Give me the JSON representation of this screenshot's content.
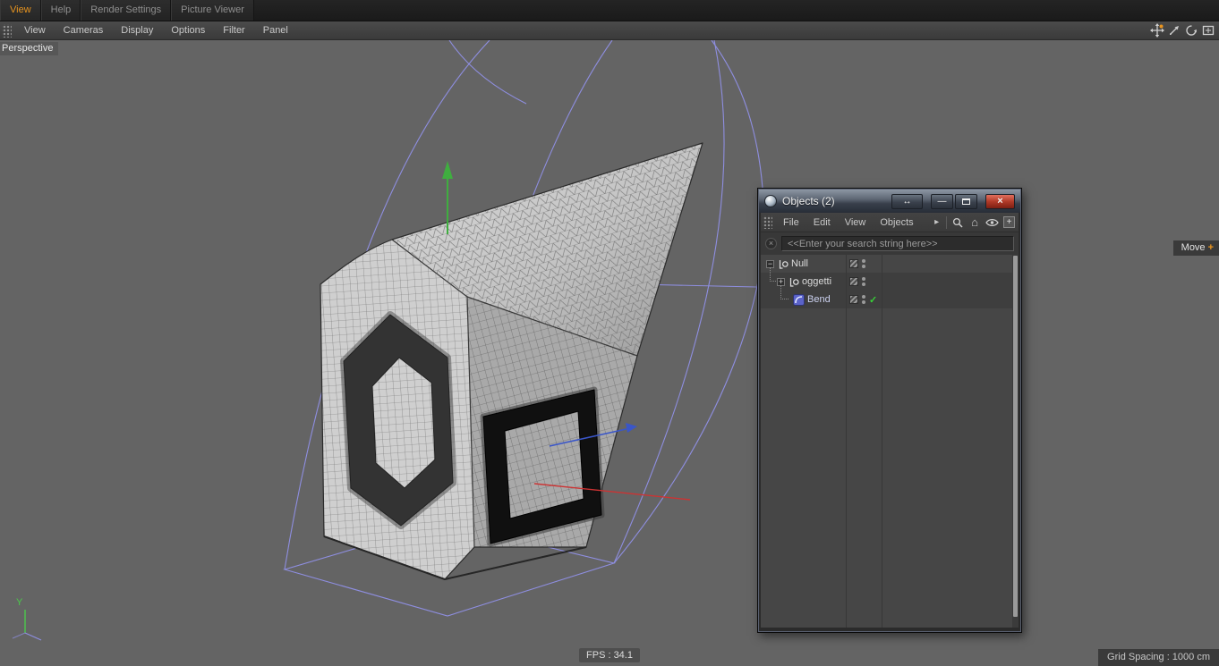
{
  "colors": {
    "accent_orange": "#e8941f",
    "cage_purple": "#8e8ee0",
    "axis_green": "#3fae3f",
    "axis_red": "#cc3333",
    "axis_blue": "#3a56c8",
    "check_green": "#38d038",
    "viewport_bg": "#646464"
  },
  "top_tabs": {
    "items": [
      {
        "label": "View",
        "active": true
      },
      {
        "label": "Help",
        "active": false
      },
      {
        "label": "Render Settings",
        "active": false
      },
      {
        "label": "Picture Viewer",
        "active": false
      }
    ]
  },
  "menu_bar": {
    "items": [
      "View",
      "Cameras",
      "Display",
      "Options",
      "Filter",
      "Panel"
    ]
  },
  "viewport": {
    "camera_label": "Perspective",
    "fps_label": "FPS : 34.1",
    "axis_label": "Y"
  },
  "status": {
    "grid_spacing": "Grid Spacing : 1000 cm",
    "tool_label": "Move"
  },
  "objects_window": {
    "title": "Objects (2)",
    "menu_items": [
      "File",
      "Edit",
      "View",
      "Objects"
    ],
    "search_value": "<<Enter your search string here>>",
    "tree": [
      {
        "label": "Null"
      },
      {
        "label": "oggetti"
      },
      {
        "label": "Bend"
      }
    ]
  },
  "icons": {
    "minus": "−",
    "plus": "+",
    "check": "✓",
    "close": "×",
    "minimize": "—",
    "dock": "↔",
    "home": "⌂",
    "menu_arrow": "▸",
    "clear": "×",
    "tool_plus": "+"
  }
}
